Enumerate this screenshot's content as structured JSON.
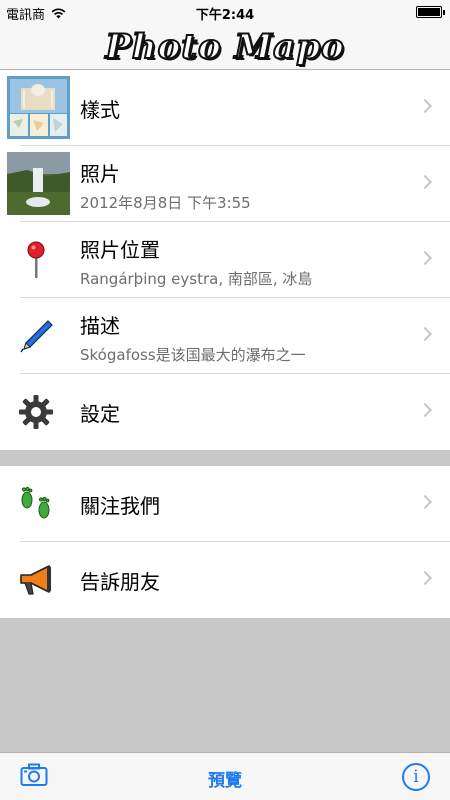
{
  "status_bar": {
    "carrier": "電訊商",
    "time": "下午2:44"
  },
  "header": {
    "logo_text": "Photo Mapo"
  },
  "rows": [
    {
      "title": "樣式",
      "subtitle": ""
    },
    {
      "title": "照片",
      "subtitle": "2012年8月8日 下午3:55"
    },
    {
      "title": "照片位置",
      "subtitle": "Rangárþing eystra, 南部區, 冰島"
    },
    {
      "title": "描述",
      "subtitle": "Skógafoss是该国最大的瀑布之一"
    },
    {
      "title": "設定",
      "subtitle": ""
    },
    {
      "title": "關注我們",
      "subtitle": ""
    },
    {
      "title": "告訴朋友",
      "subtitle": ""
    }
  ],
  "tabbar": {
    "preview_label": "預覽",
    "info_symbol": "i"
  },
  "colors": {
    "accent": "#1e7cf0",
    "background_gray": "#c8c8c8"
  }
}
